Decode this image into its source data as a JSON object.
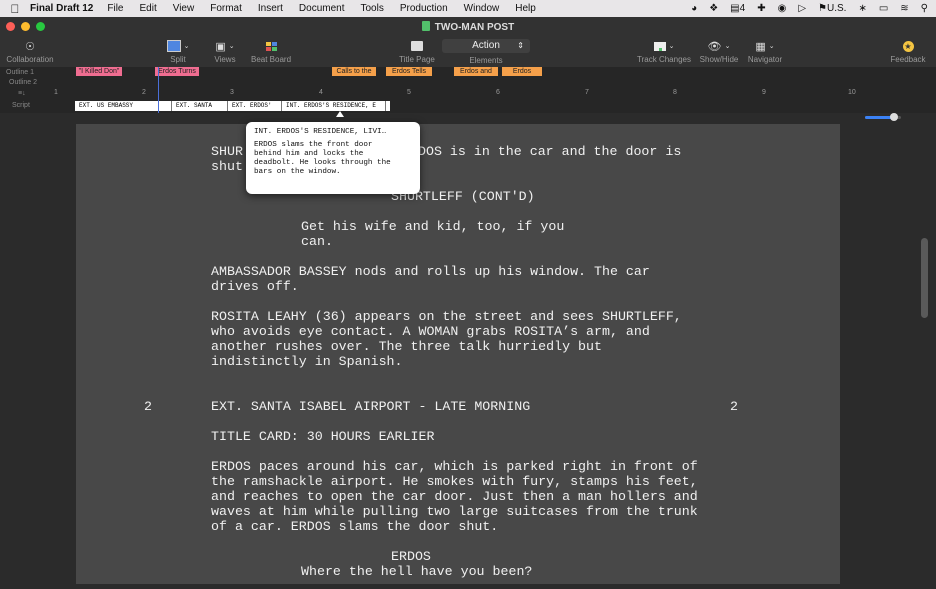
{
  "menubar": {
    "app_name": "Final Draft 12",
    "items": [
      "File",
      "Edit",
      "View",
      "Format",
      "Insert",
      "Document",
      "Tools",
      "Production",
      "Window",
      "Help"
    ],
    "badge_count": "4",
    "input_source": "U.S."
  },
  "window": {
    "title": "TWO-MAN POST"
  },
  "toolbar": {
    "collaboration": "Collaboration",
    "split": "Split",
    "views": "Views",
    "beat_board": "Beat Board",
    "title_page": "Title Page",
    "elements_value": "Action",
    "elements": "Elements",
    "track_changes": "Track Changes",
    "show_hide": "Show/Hide",
    "navigator": "Navigator",
    "feedback": "Feedback"
  },
  "outline": {
    "outline1_label": "Outline 1",
    "outline2_label": "Outline 2",
    "script_label": "Script",
    "chips": [
      {
        "text": "\"I Killed Don\"",
        "color": "#f06d91"
      },
      {
        "text": "Erdos Turns",
        "color": "#f06d91"
      },
      {
        "text": "Calls to the",
        "color": "#f5a04a"
      },
      {
        "text": "Erdos Tells",
        "color": "#f5a04a"
      },
      {
        "text": "Erdos and",
        "color": "#f5a04a"
      },
      {
        "text": "Erdos",
        "color": "#f5a04a"
      }
    ],
    "ruler_ticks": [
      "1",
      "2",
      "3",
      "4",
      "5",
      "6",
      "7",
      "8",
      "9",
      "10"
    ],
    "scenes": [
      "EXT. US EMBASSY",
      "EXT. SANTA",
      "EXT. ERDOS'",
      "INT. ERDOS'S RESIDENCE, E"
    ]
  },
  "popover": {
    "heading": "INT. ERDOS'S RESIDENCE, LIVI…",
    "body": "ERDOS slams the front door\nbehind him and locks the\ndeadbolt. He looks through the\nbars on the window."
  },
  "script": {
    "l1a": "SHUR",
    "l1b": "DOS is in the car and the door is",
    "l2a": "shut",
    "char1": "SHURTLEFF (CONT'D)",
    "dial1": "Get his wife and kid, too, if you\ncan.",
    "action1": "AMBASSADOR BASSEY nods and rolls up his window. The car\ndrives off.",
    "action2": "ROSITA LEAHY (36) appears on the street and sees SHURTLEFF,\nwho avoids eye contact. A WOMAN grabs ROSITA’s arm, and\nanother rushes over. The three talk hurriedly but\nindistinctly in Spanish.",
    "scene_num_left": "2",
    "scene_heading": "EXT. SANTA ISABEL AIRPORT - LATE MORNING",
    "scene_num_right": "2",
    "title_card": "TITLE CARD: 30 HOURS EARLIER",
    "action3": "ERDOS paces around his car, which is parked right in front of\nthe ramshackle airport. He smokes with fury, stamps his feet,\nand reaches to open the car door. Just then a man hollers and\nwaves at him while pulling two large suitcases from the trunk\nof a car. ERDOS slams the door shut.",
    "char2": "ERDOS",
    "dial2": "Where the hell have you been?"
  }
}
